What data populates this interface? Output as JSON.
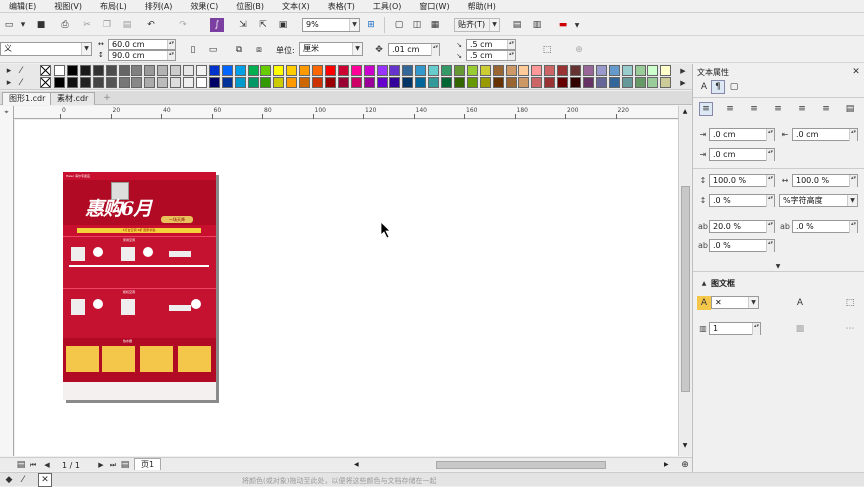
{
  "menu": [
    "编辑(E)",
    "视图(V)",
    "布局(L)",
    "排列(A)",
    "效果(C)",
    "位图(B)",
    "文本(X)",
    "表格(T)",
    "工具(O)",
    "窗口(W)",
    "帮助(H)"
  ],
  "toolbar": {
    "zoom": "9%",
    "snap": "贴齐(T)"
  },
  "propbar": {
    "preset": "义",
    "width": "60.0 cm",
    "height": "90.0 cm",
    "unit_label": "单位:",
    "unit": "厘米",
    "nudge": ".01 cm",
    "dup_x": ".5 cm",
    "dup_y": ".5 cm"
  },
  "tabs": [
    "图形1.cdr",
    "素材.cdr"
  ],
  "ruler_labels": [
    "0",
    "20",
    "40",
    "60",
    "80",
    "100",
    "120",
    "140",
    "160",
    "180",
    "200",
    "220"
  ],
  "pages": {
    "current": "1 / 1",
    "page_tab": "页1"
  },
  "status_text": "将颜色(或对象)拖动至此处，以便将这些颜色与文档存储在一起",
  "panel": {
    "title": "文本属性",
    "indent_left": ".0 cm",
    "indent_right": ".0 cm",
    "indent_first": ".0 cm",
    "char_spacing": "100.0 %",
    "word_spacing": "100.0 %",
    "before_para": ".0 %",
    "line_spacing_mode": "%字符高度",
    "lang_spacing": "20.0 %",
    "char_spacing2": ".0 %",
    "line_spacing": ".0 %",
    "frame_title": "图文框",
    "columns": "1"
  },
  "poster": {
    "header_left": "Haier 海尔专卖店",
    "headline": "惠购6月",
    "badge": "一场天降",
    "tagline": "4万台空调 9折 国家补贴",
    "section1": "家用空调",
    "section2": "柜机空调",
    "section3": "热水器"
  },
  "colors": {
    "accent": "#d5122e",
    "palette": [
      "#ffffff",
      "#000000",
      "#1a1a1a",
      "#333333",
      "#4d4d4d",
      "#666666",
      "#808080",
      "#999999",
      "#b3b3b3",
      "#cccccc",
      "#e6e6e6",
      "#f2f2f2",
      "#0033cc",
      "#0066ff",
      "#00a0e9",
      "#00b050",
      "#66cc00",
      "#ffff00",
      "#ffcc00",
      "#ff9900",
      "#ff6600",
      "#ff0000",
      "#cc0033",
      "#ff0099",
      "#cc00cc",
      "#9933ff",
      "#6633cc",
      "#336699",
      "#3399cc",
      "#66cccc",
      "#339966",
      "#669933",
      "#99cc33",
      "#cccc33",
      "#996633",
      "#cc9966",
      "#ffcc99",
      "#ff9999",
      "#cc6666",
      "#993333",
      "#663333",
      "#996699",
      "#9999cc",
      "#6699cc",
      "#99cccc",
      "#99cc99",
      "#ccffcc",
      "#ffffcc"
    ],
    "palette_row2": [
      "#000000",
      "#111111",
      "#222222",
      "#444444",
      "#555555",
      "#777777",
      "#888888",
      "#aaaaaa",
      "#bbbbbb",
      "#dddddd",
      "#eeeeee",
      "#ffffff",
      "#000066",
      "#003399",
      "#0099cc",
      "#009966",
      "#339900",
      "#cccc00",
      "#ff9900",
      "#cc6600",
      "#cc3300",
      "#990000",
      "#990033",
      "#cc0066",
      "#990099",
      "#6600cc",
      "#330099",
      "#003366",
      "#006699",
      "#339999",
      "#006633",
      "#336600",
      "#669900",
      "#999900",
      "#663300",
      "#996633",
      "#cc9966",
      "#cc6666",
      "#993333",
      "#660000",
      "#330000",
      "#663366",
      "#666699",
      "#336699",
      "#669999",
      "#669966",
      "#99cc99",
      "#cccc99"
    ]
  }
}
